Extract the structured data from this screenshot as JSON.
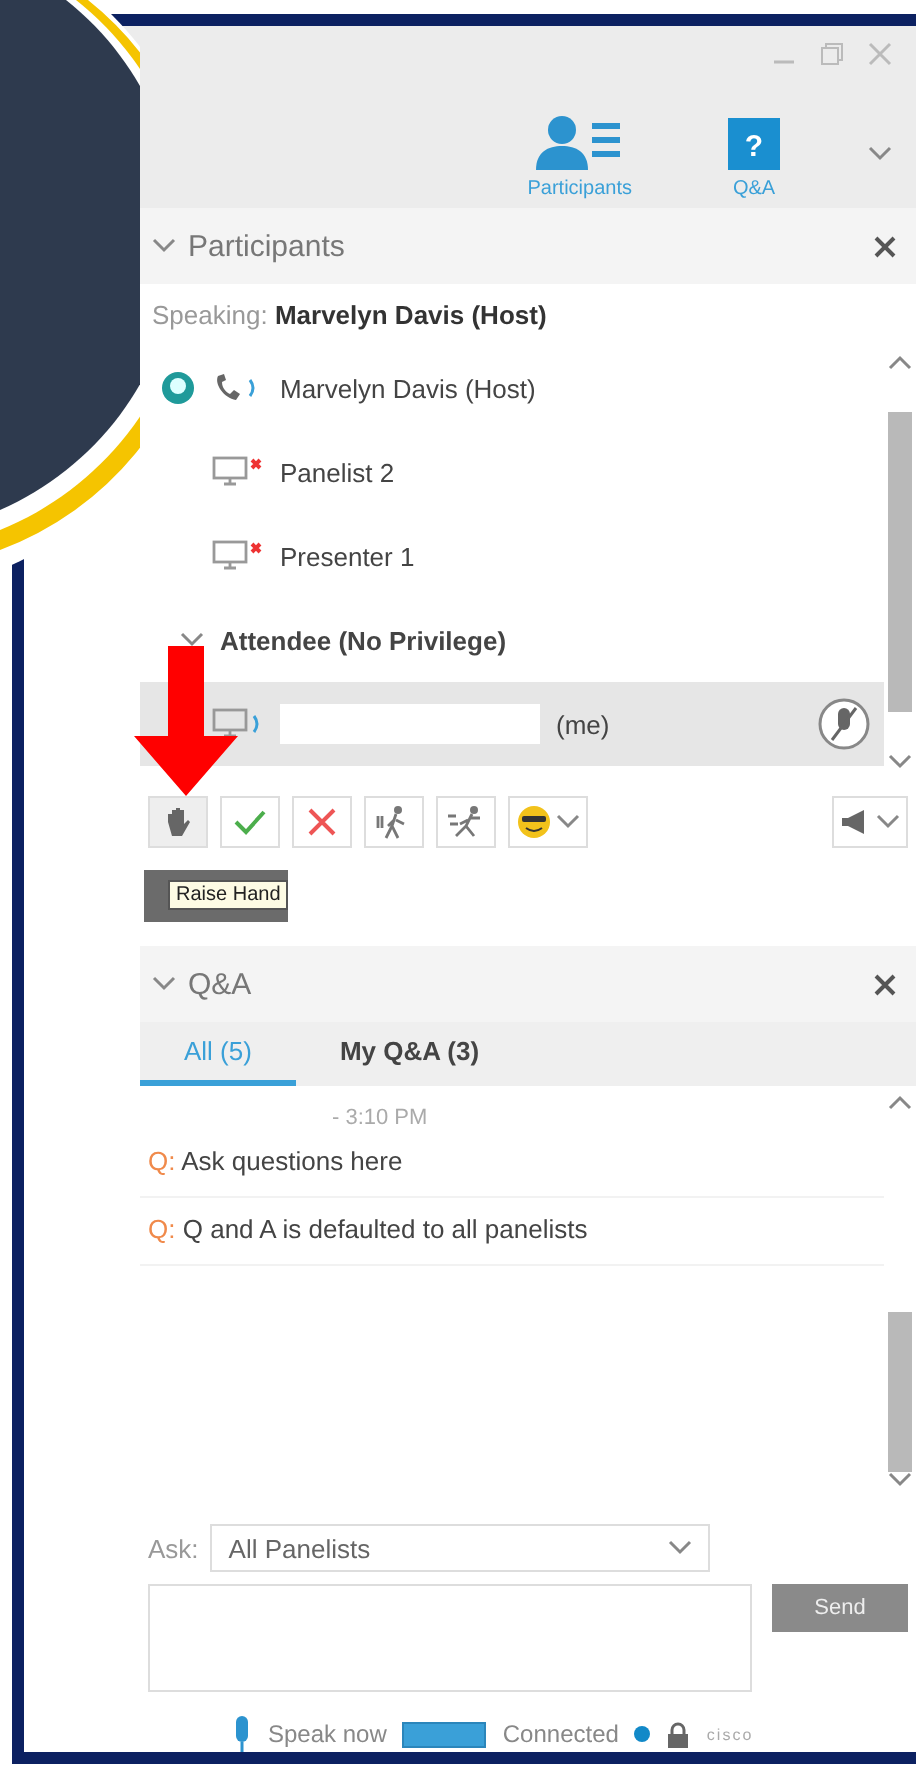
{
  "top_tabs": [
    {
      "label": "Participants",
      "kind": "participants"
    },
    {
      "label": "Q&A",
      "kind": "qa",
      "glyph": "?"
    }
  ],
  "participants_panel": {
    "title": "Participants",
    "speaking_label": "Speaking:",
    "speaking_name": "Marvelyn Davis (Host)",
    "list": [
      {
        "name": "Marvelyn Davis (Host)",
        "kind": "host",
        "selected": false
      },
      {
        "name": "Panelist 2",
        "kind": "panelist",
        "selected": false
      },
      {
        "name": "Presenter 1",
        "kind": "panelist",
        "selected": false
      },
      {
        "name": "Attendee (No Privilege)",
        "kind": "group",
        "selected": false
      },
      {
        "name": "(me)",
        "kind": "me",
        "selected": true
      }
    ]
  },
  "toolbar": [
    {
      "kind": "raise_hand"
    },
    {
      "kind": "yes"
    },
    {
      "kind": "no"
    },
    {
      "kind": "slower"
    },
    {
      "kind": "faster"
    },
    {
      "kind": "emoticon"
    }
  ],
  "tooltip": "Raise Hand",
  "qa_panel": {
    "title": "Q&A",
    "tabs": [
      {
        "label": "All (5)",
        "selected": true
      },
      {
        "label": "My Q&A (3)",
        "selected": false
      }
    ],
    "time": "- 3:10 PM",
    "questions": [
      {
        "prefix": "Q:",
        "text": "Ask questions here"
      },
      {
        "prefix": "Q:",
        "text": "Q and A is defaulted to all panelists"
      }
    ],
    "ask_label": "Ask:",
    "ask_target": "All Panelists",
    "send": "Send"
  },
  "status_bar": {
    "speak": "Speak now",
    "connection": "Connected",
    "logo": "cisco"
  }
}
